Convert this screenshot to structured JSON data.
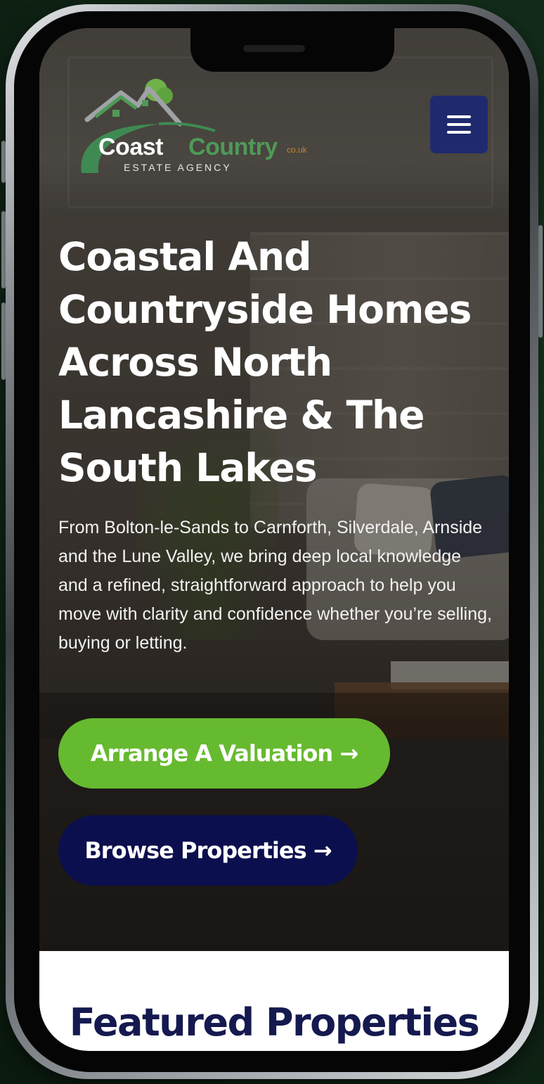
{
  "header": {
    "logo": {
      "word_coast": "Coast",
      "word_country": "Country",
      "domain_suffix": "co.uk",
      "tagline": "ESTATE AGENCY"
    },
    "menu_icon": "hamburger-menu-icon"
  },
  "hero": {
    "headline": "Coastal And Countryside Homes Across North Lancashire & The South Lakes",
    "intro": "From Bolton-le-Sands to Carnforth, Silverdale, Arnside and the Lune Valley, we bring deep local knowledge and a refined, straightforward approach to help you move with clarity and confidence whether you’re selling, buying or letting.",
    "buttons": {
      "valuation": "Arrange A Valuation →",
      "browse": "Browse Properties →"
    }
  },
  "featured": {
    "title": "Featured Properties"
  },
  "colors": {
    "valuation_button": "#66ba2f",
    "browse_button": "#0b0f4d",
    "menu_button": "#1f2a6e",
    "brand_green": "#4e9a57",
    "heading_navy": "#14194f"
  }
}
